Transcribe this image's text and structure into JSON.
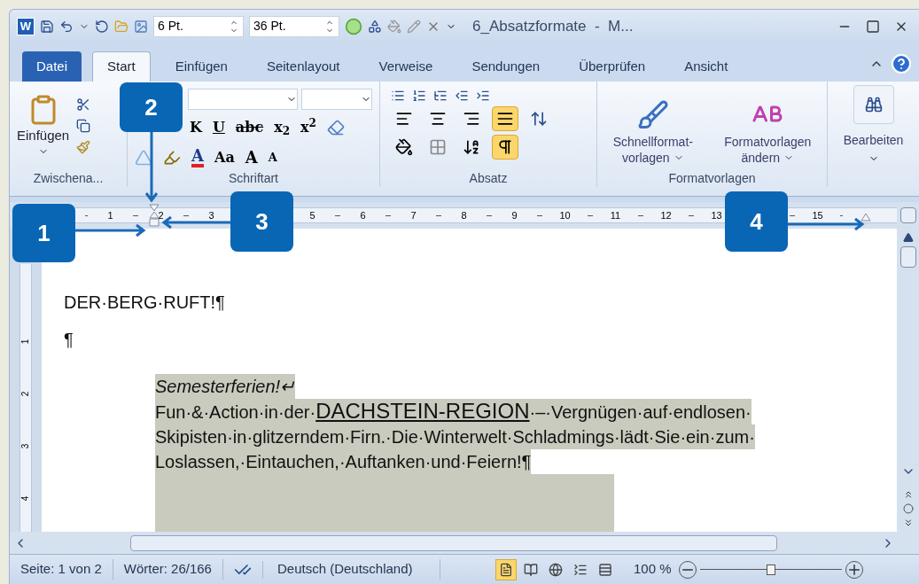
{
  "quick_access": {
    "app_icon": "W",
    "fields": [
      {
        "value": "6 Pt."
      },
      {
        "value": "36 Pt."
      }
    ]
  },
  "window": {
    "title": "6_Absatzformate  -  M..."
  },
  "tabs": [
    {
      "label": "Datei",
      "kind": "file",
      "selected": false
    },
    {
      "label": "Start",
      "kind": "tab",
      "selected": true
    },
    {
      "label": "Einfügen",
      "kind": "tab",
      "selected": false
    },
    {
      "label": "Seitenlayout",
      "kind": "tab",
      "selected": false
    },
    {
      "label": "Verweise",
      "kind": "tab",
      "selected": false
    },
    {
      "label": "Sendungen",
      "kind": "tab",
      "selected": false
    },
    {
      "label": "Überprüfen",
      "kind": "tab",
      "selected": false
    },
    {
      "label": "Ansicht",
      "kind": "tab",
      "selected": false
    }
  ],
  "ribbon": {
    "clipboard": {
      "label": "Zwischena...",
      "paste": "Einfügen"
    },
    "font": {
      "label": "Schriftart",
      "row1": [
        "K",
        "U",
        "abc",
        "x$_{2}$",
        "x$^{2}$"
      ],
      "color_glyph": "A",
      "case_glyph": "Aa",
      "grow_glyph": "A",
      "shrink_glyph": "A"
    },
    "paragraph": {
      "label": "Absatz",
      "justify_on": true,
      "marks_on": true
    },
    "styles": {
      "label": "Formatvorlagen",
      "buttons": [
        {
          "lines": [
            "Schnellformat-",
            "vorlagen"
          ]
        },
        {
          "lines": [
            "Formatvorlagen",
            "ändern"
          ]
        }
      ]
    },
    "editing": {
      "label": "Bearbeiten"
    }
  },
  "ruler": {
    "cells": [
      {
        "label": "1"
      },
      {
        "label": "2"
      },
      {
        "label": "3"
      },
      {},
      {
        "label": "5"
      },
      {
        "label": "6"
      },
      {
        "label": "7"
      },
      {
        "label": "8"
      },
      {
        "label": "9"
      },
      {
        "label": "10"
      },
      {
        "label": "11"
      },
      {
        "label": "12"
      },
      {
        "label": "13"
      },
      {},
      {
        "label": "15"
      }
    ]
  },
  "vertical_ruler": {
    "labels": [
      "1",
      "2",
      "3",
      "4"
    ]
  },
  "document": {
    "title": "DER·BERG·RUFT!¶",
    "empty_mark": "¶",
    "block": {
      "shaded": true,
      "heading": "Semesterferien!↵",
      "lines": [
        [
          {
            "text": "Fun·&·Action·in·der·",
            "kind": "plain"
          },
          {
            "text": "DACHSTEIN-REGION",
            "kind": "emphasis"
          },
          {
            "text": "·–·Vergnügen·auf·endlosen·",
            "kind": "plain"
          }
        ],
        [
          {
            "text": "Skipisten·in·glitzerndem·Firn.·Die·Winterwelt·Schladmings·lädt·Sie·ein·zum·",
            "kind": "plain"
          }
        ],
        [
          {
            "text": "Loslassen,·Eintauchen,·Auftanken·und·Feiern!¶",
            "kind": "plain"
          }
        ]
      ]
    }
  },
  "status_bar": {
    "page": "Seite: 1 von 2",
    "words": "Wörter: 26/166",
    "language": "Deutsch (Deutschland)",
    "views": [
      {
        "kind": "print",
        "selected": true
      },
      {
        "kind": "read",
        "selected": false
      },
      {
        "kind": "web",
        "selected": false
      },
      {
        "kind": "outline",
        "selected": false
      },
      {
        "kind": "draft",
        "selected": false
      }
    ],
    "zoom": {
      "label": "100 %",
      "level": 0.5
    }
  },
  "callouts": [
    {
      "label": "1"
    },
    {
      "label": "2"
    },
    {
      "label": "3"
    },
    {
      "label": "4"
    }
  ]
}
